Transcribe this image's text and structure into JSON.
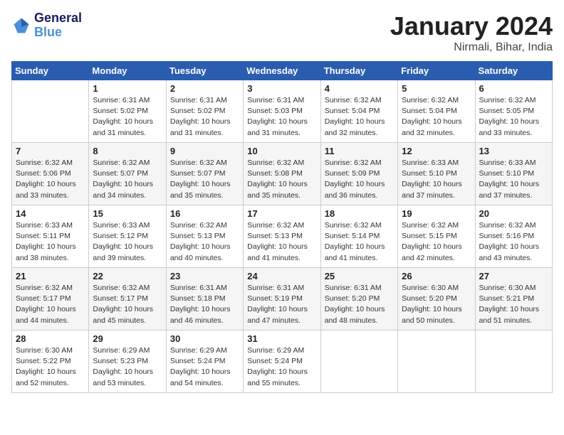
{
  "logo": {
    "line1": "General",
    "line2": "Blue"
  },
  "title": "January 2024",
  "location": "Nirmali, Bihar, India",
  "header": {
    "days": [
      "Sunday",
      "Monday",
      "Tuesday",
      "Wednesday",
      "Thursday",
      "Friday",
      "Saturday"
    ]
  },
  "weeks": [
    [
      {
        "day": "",
        "sunrise": "",
        "sunset": "",
        "daylight": ""
      },
      {
        "day": "1",
        "sunrise": "Sunrise: 6:31 AM",
        "sunset": "Sunset: 5:02 PM",
        "daylight": "Daylight: 10 hours and 31 minutes."
      },
      {
        "day": "2",
        "sunrise": "Sunrise: 6:31 AM",
        "sunset": "Sunset: 5:02 PM",
        "daylight": "Daylight: 10 hours and 31 minutes."
      },
      {
        "day": "3",
        "sunrise": "Sunrise: 6:31 AM",
        "sunset": "Sunset: 5:03 PM",
        "daylight": "Daylight: 10 hours and 31 minutes."
      },
      {
        "day": "4",
        "sunrise": "Sunrise: 6:32 AM",
        "sunset": "Sunset: 5:04 PM",
        "daylight": "Daylight: 10 hours and 32 minutes."
      },
      {
        "day": "5",
        "sunrise": "Sunrise: 6:32 AM",
        "sunset": "Sunset: 5:04 PM",
        "daylight": "Daylight: 10 hours and 32 minutes."
      },
      {
        "day": "6",
        "sunrise": "Sunrise: 6:32 AM",
        "sunset": "Sunset: 5:05 PM",
        "daylight": "Daylight: 10 hours and 33 minutes."
      }
    ],
    [
      {
        "day": "7",
        "sunrise": "Sunrise: 6:32 AM",
        "sunset": "Sunset: 5:06 PM",
        "daylight": "Daylight: 10 hours and 33 minutes."
      },
      {
        "day": "8",
        "sunrise": "Sunrise: 6:32 AM",
        "sunset": "Sunset: 5:07 PM",
        "daylight": "Daylight: 10 hours and 34 minutes."
      },
      {
        "day": "9",
        "sunrise": "Sunrise: 6:32 AM",
        "sunset": "Sunset: 5:07 PM",
        "daylight": "Daylight: 10 hours and 35 minutes."
      },
      {
        "day": "10",
        "sunrise": "Sunrise: 6:32 AM",
        "sunset": "Sunset: 5:08 PM",
        "daylight": "Daylight: 10 hours and 35 minutes."
      },
      {
        "day": "11",
        "sunrise": "Sunrise: 6:32 AM",
        "sunset": "Sunset: 5:09 PM",
        "daylight": "Daylight: 10 hours and 36 minutes."
      },
      {
        "day": "12",
        "sunrise": "Sunrise: 6:33 AM",
        "sunset": "Sunset: 5:10 PM",
        "daylight": "Daylight: 10 hours and 37 minutes."
      },
      {
        "day": "13",
        "sunrise": "Sunrise: 6:33 AM",
        "sunset": "Sunset: 5:10 PM",
        "daylight": "Daylight: 10 hours and 37 minutes."
      }
    ],
    [
      {
        "day": "14",
        "sunrise": "Sunrise: 6:33 AM",
        "sunset": "Sunset: 5:11 PM",
        "daylight": "Daylight: 10 hours and 38 minutes."
      },
      {
        "day": "15",
        "sunrise": "Sunrise: 6:33 AM",
        "sunset": "Sunset: 5:12 PM",
        "daylight": "Daylight: 10 hours and 39 minutes."
      },
      {
        "day": "16",
        "sunrise": "Sunrise: 6:32 AM",
        "sunset": "Sunset: 5:13 PM",
        "daylight": "Daylight: 10 hours and 40 minutes."
      },
      {
        "day": "17",
        "sunrise": "Sunrise: 6:32 AM",
        "sunset": "Sunset: 5:13 PM",
        "daylight": "Daylight: 10 hours and 41 minutes."
      },
      {
        "day": "18",
        "sunrise": "Sunrise: 6:32 AM",
        "sunset": "Sunset: 5:14 PM",
        "daylight": "Daylight: 10 hours and 41 minutes."
      },
      {
        "day": "19",
        "sunrise": "Sunrise: 6:32 AM",
        "sunset": "Sunset: 5:15 PM",
        "daylight": "Daylight: 10 hours and 42 minutes."
      },
      {
        "day": "20",
        "sunrise": "Sunrise: 6:32 AM",
        "sunset": "Sunset: 5:16 PM",
        "daylight": "Daylight: 10 hours and 43 minutes."
      }
    ],
    [
      {
        "day": "21",
        "sunrise": "Sunrise: 6:32 AM",
        "sunset": "Sunset: 5:17 PM",
        "daylight": "Daylight: 10 hours and 44 minutes."
      },
      {
        "day": "22",
        "sunrise": "Sunrise: 6:32 AM",
        "sunset": "Sunset: 5:17 PM",
        "daylight": "Daylight: 10 hours and 45 minutes."
      },
      {
        "day": "23",
        "sunrise": "Sunrise: 6:31 AM",
        "sunset": "Sunset: 5:18 PM",
        "daylight": "Daylight: 10 hours and 46 minutes."
      },
      {
        "day": "24",
        "sunrise": "Sunrise: 6:31 AM",
        "sunset": "Sunset: 5:19 PM",
        "daylight": "Daylight: 10 hours and 47 minutes."
      },
      {
        "day": "25",
        "sunrise": "Sunrise: 6:31 AM",
        "sunset": "Sunset: 5:20 PM",
        "daylight": "Daylight: 10 hours and 48 minutes."
      },
      {
        "day": "26",
        "sunrise": "Sunrise: 6:30 AM",
        "sunset": "Sunset: 5:20 PM",
        "daylight": "Daylight: 10 hours and 50 minutes."
      },
      {
        "day": "27",
        "sunrise": "Sunrise: 6:30 AM",
        "sunset": "Sunset: 5:21 PM",
        "daylight": "Daylight: 10 hours and 51 minutes."
      }
    ],
    [
      {
        "day": "28",
        "sunrise": "Sunrise: 6:30 AM",
        "sunset": "Sunset: 5:22 PM",
        "daylight": "Daylight: 10 hours and 52 minutes."
      },
      {
        "day": "29",
        "sunrise": "Sunrise: 6:29 AM",
        "sunset": "Sunset: 5:23 PM",
        "daylight": "Daylight: 10 hours and 53 minutes."
      },
      {
        "day": "30",
        "sunrise": "Sunrise: 6:29 AM",
        "sunset": "Sunset: 5:24 PM",
        "daylight": "Daylight: 10 hours and 54 minutes."
      },
      {
        "day": "31",
        "sunrise": "Sunrise: 6:29 AM",
        "sunset": "Sunset: 5:24 PM",
        "daylight": "Daylight: 10 hours and 55 minutes."
      },
      {
        "day": "",
        "sunrise": "",
        "sunset": "",
        "daylight": ""
      },
      {
        "day": "",
        "sunrise": "",
        "sunset": "",
        "daylight": ""
      },
      {
        "day": "",
        "sunrise": "",
        "sunset": "",
        "daylight": ""
      }
    ]
  ]
}
